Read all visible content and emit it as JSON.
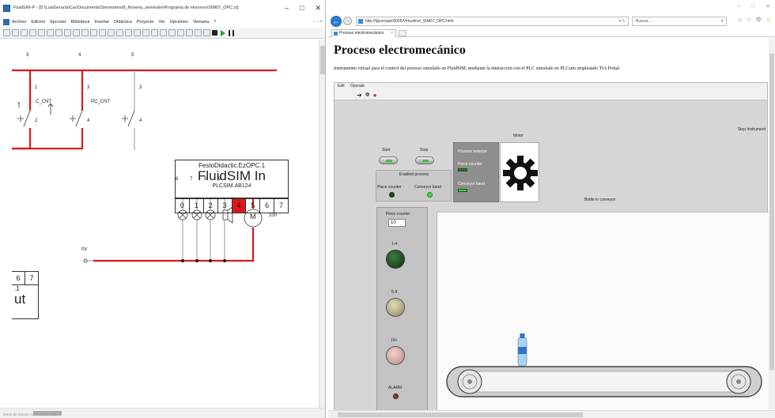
{
  "fluidsim": {
    "window_title": "FluidSIM-P - [D:\\LuisGerardoCar\\Documents\\Semestres\\8_Noveno_semestre\\Programa de Honores\\SIM07_OPC.ct]",
    "window_controls": [
      "–",
      "□",
      "✕"
    ],
    "menu": [
      "Archivo",
      "Edición",
      "Ejecutar",
      "Biblioteca",
      "Insertar",
      "Didáctica",
      "Proyecto",
      "Ver",
      "Opciones",
      "Ventana",
      "?"
    ],
    "mdi_controls": "- ▫ ×",
    "status_text": "Modo de edición (Ctrl+Doble clic)",
    "circuit": {
      "top_numbers": [
        "3",
        "4",
        "5"
      ],
      "contacts": [
        {
          "name": "C_CNT",
          "top": "1",
          "bottom": "2"
        },
        {
          "name": "PC_CNT",
          "top": "3",
          "bottom": "4"
        }
      ],
      "right_contact_numbers": [
        "3",
        "4"
      ],
      "opc_block": {
        "line1": "FestoDidactic.EzOPC.1",
        "line2": "FluidSIM In",
        "line3": "PLCSIM.AB124",
        "terminals": [
          "0",
          "1",
          "2",
          "3",
          "4",
          "5",
          "6",
          "7"
        ],
        "active_terminal": "4"
      },
      "lower_numbers": [
        "6",
        "7",
        "8",
        "9"
      ],
      "motor_label": "M",
      "motor_value": "100",
      "zero_volt": "0V",
      "left_block": {
        "numbers": [
          "6",
          "7"
        ],
        "sub": ".1",
        "text": "ut"
      }
    }
  },
  "browser": {
    "url": "http://fgcarvajal:8005/VirtualInst_SIM07_OPC.html",
    "search_placeholder": "Buscar...",
    "tab_title": "Proceso electromecánico",
    "window_controls": [
      "–",
      "□",
      "✕"
    ],
    "page_title": "Proceso electromecánico",
    "page_description": "Instrumento virtual para el control del proceso simulado en FluidSIM, mediante la interacción con el PLC simulado en PLCsim empleando TIA Portal.",
    "vi": {
      "menu": [
        "Edit",
        "Operate"
      ],
      "stop_instrument": "Stop Instrument",
      "start_label": "Start",
      "stop_label": "Stop",
      "motor_label": "Motor",
      "process_selector": {
        "title": "Process selector",
        "piece_counter": "Piece counter",
        "conveyor_band": "Conveyor band",
        "piece_counter_on": false,
        "conveyor_band_on": true
      },
      "enabled_process": {
        "title": "Enabled process:",
        "piece_counter": "Piece counter",
        "conveyor_band": "Conveyor band",
        "piece_counter_on": false,
        "conveyor_band_on": true
      },
      "bottle_label": "Bottle in conveyor",
      "side_panel": {
        "counter_label": "Piece counter",
        "counter_value": "10",
        "leds": [
          {
            "label": "1-4",
            "color": "#1d4a1d"
          },
          {
            "label": "5-9",
            "color": "#b6b088"
          },
          {
            "label": "10+",
            "color": "#dcaaa4"
          }
        ],
        "alarm_label": "ALARM",
        "alarm_color": "#8a3b3b"
      }
    }
  },
  "colors": {
    "wire_red": "#e0171a",
    "wire_gray": "#888888",
    "accent_blue": "#2d7fd0"
  }
}
